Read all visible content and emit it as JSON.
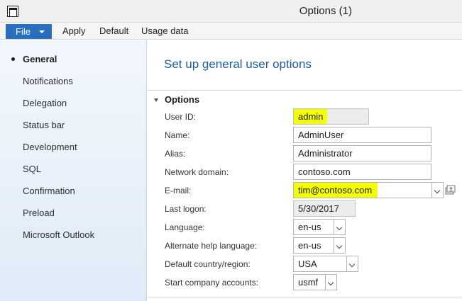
{
  "window": {
    "title": "Options (1)"
  },
  "toolbar": {
    "file_label": "File",
    "apply_label": "Apply",
    "default_label": "Default",
    "usage_label": "Usage data"
  },
  "nav": {
    "items": [
      {
        "label": "General",
        "active": true
      },
      {
        "label": "Notifications"
      },
      {
        "label": "Delegation"
      },
      {
        "label": "Status bar"
      },
      {
        "label": "Development"
      },
      {
        "label": "SQL"
      },
      {
        "label": "Confirmation"
      },
      {
        "label": "Preload"
      },
      {
        "label": "Microsoft Outlook"
      }
    ]
  },
  "main": {
    "title": "Set up general user options",
    "section_label": "Options",
    "fields": {
      "user_id": {
        "label": "User ID:",
        "value": "admin",
        "highlight_color": "#f4ff00"
      },
      "name": {
        "label": "Name:",
        "value": "AdminUser"
      },
      "alias": {
        "label": "Alias:",
        "value": "Administrator"
      },
      "network_domain": {
        "label": "Network domain:",
        "value": "contoso.com"
      },
      "email": {
        "label": "E-mail:",
        "value": "tim@contoso.com",
        "highlight_color": "#f4ff00"
      },
      "last_logon": {
        "label": "Last logon:",
        "value": "5/30/2017"
      },
      "language": {
        "label": "Language:",
        "value": "en-us"
      },
      "alt_help_language": {
        "label": "Alternate help language:",
        "value": "en-us"
      },
      "country_region": {
        "label": "Default country/region:",
        "value": "USA"
      },
      "start_company": {
        "label": "Start company accounts:",
        "value": "usmf"
      }
    }
  },
  "colors": {
    "accent": "#2a6ebe",
    "title_blue": "#1e5c9c",
    "highlight": "#f4ff00"
  },
  "icons": {
    "app": "app-window-icon",
    "lookup": "address-book-lookup-icon"
  }
}
